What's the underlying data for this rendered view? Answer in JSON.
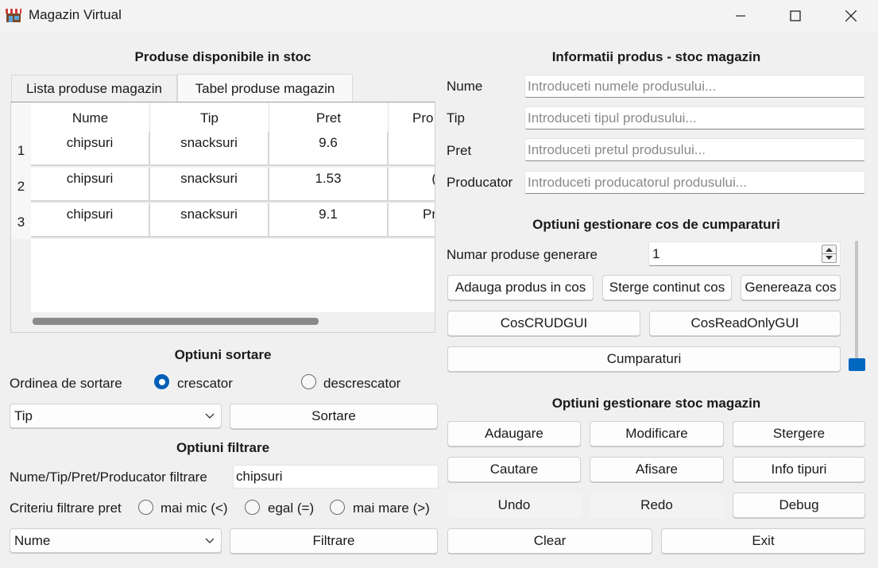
{
  "window": {
    "title": "Magazin Virtual"
  },
  "left": {
    "stock_heading": "Produse disponibile in stoc",
    "tabs": [
      "Lista produse magazin",
      "Tabel produse magazin"
    ],
    "table": {
      "headers": [
        "Nume",
        "Tip",
        "Pret",
        "Pro"
      ],
      "rows": [
        {
          "index": "1",
          "cells": [
            "chipsuri",
            "snacksuri",
            "9.6",
            ""
          ]
        },
        {
          "index": "2",
          "cells": [
            "chipsuri",
            "snacksuri",
            "1.53",
            "("
          ]
        },
        {
          "index": "3",
          "cells": [
            "chipsuri",
            "snacksuri",
            "9.1",
            "Pr"
          ]
        }
      ]
    },
    "sort": {
      "heading": "Optiuni sortare",
      "order_label": "Ordinea de sortare",
      "asc_label": "crescator",
      "desc_label": "descrescator",
      "selected": "crescator",
      "field_value": "Tip",
      "button": "Sortare"
    },
    "filter": {
      "heading": "Optiuni filtrare",
      "field_label": "Nume/Tip/Pret/Producator filtrare",
      "field_value": "chipsuri",
      "price_label": "Criteriu filtrare pret",
      "price_options": [
        "mai mic (<)",
        "egal (=)",
        "mai mare (>)"
      ],
      "combo_value": "Nume",
      "button": "Filtrare"
    }
  },
  "right": {
    "info_heading": "Informatii produs - stoc magazin",
    "fields": [
      {
        "label": "Nume",
        "placeholder": "Introduceti numele produsului..."
      },
      {
        "label": "Tip",
        "placeholder": "Introduceti tipul produsului..."
      },
      {
        "label": "Pret",
        "placeholder": "Introduceti pretul produsului..."
      },
      {
        "label": "Producator",
        "placeholder": "Introduceti producatorul produsului..."
      }
    ],
    "cart": {
      "heading": "Optiuni gestionare cos de cumparaturi",
      "gen_label": "Numar produse generare",
      "gen_value": "1",
      "buttons": [
        "Adauga produs in cos",
        "Sterge continut cos",
        "Genereaza cos"
      ],
      "buttons2": [
        "CosCRUDGUI",
        "CosReadOnlyGUI"
      ],
      "buy_button": "Cumparaturi"
    },
    "stock": {
      "heading": "Optiuni gestionare stoc magazin",
      "row1": [
        "Adaugare",
        "Modificare",
        "Stergere"
      ],
      "row2": [
        "Cautare",
        "Afisare",
        "Info tipuri"
      ],
      "row3": [
        "Undo",
        "Redo",
        "Debug"
      ],
      "row4": [
        "Clear",
        "Exit"
      ]
    }
  },
  "colors": {
    "accent": "#005fb8",
    "slider_handle": "#0067c0"
  }
}
